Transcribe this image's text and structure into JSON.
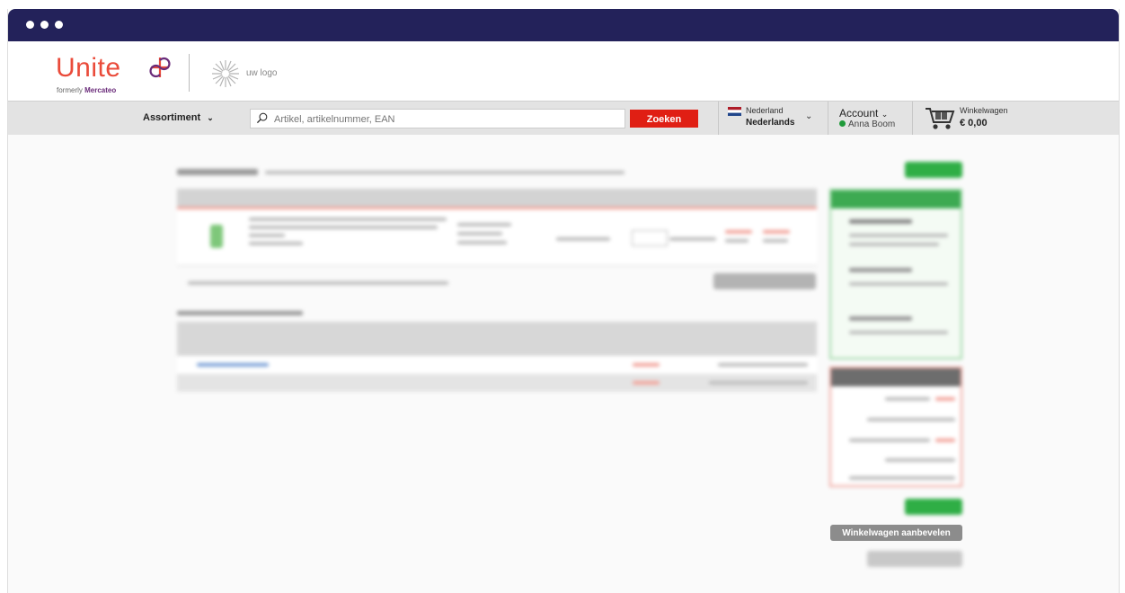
{
  "window": {
    "accent": "#23225a"
  },
  "brand": {
    "name": "Unite",
    "formerly_prefix": "formerly",
    "formerly_name": "Mercateo",
    "partner_logo_text": "uw logo",
    "colors": {
      "primary": "#ea4b3a",
      "secondary": "#6a2b7a"
    }
  },
  "nav": {
    "assortment_label": "Assortiment",
    "search": {
      "placeholder": "Artikel, artikelnummer, EAN",
      "value": ""
    },
    "search_button_label": "Zoeken",
    "search_button_color": "#e01f14",
    "country_label": "Nederland",
    "language_label": "Nederlands",
    "account_label": "Account",
    "user_name": "Anna Boom",
    "user_status_color": "#1f9a3a",
    "cart_label": "Winkelwagen",
    "cart_total": "€ 0,00"
  },
  "main": {
    "recommend_button_label": "Winkelwagen aanbevelen"
  },
  "icons": [
    "search-icon",
    "chevron-down-icon",
    "netherlands-flag-icon",
    "shopping-cart-icon",
    "unite-brand-mark-icon",
    "burst-logo-icon",
    "online-status-icon"
  ]
}
